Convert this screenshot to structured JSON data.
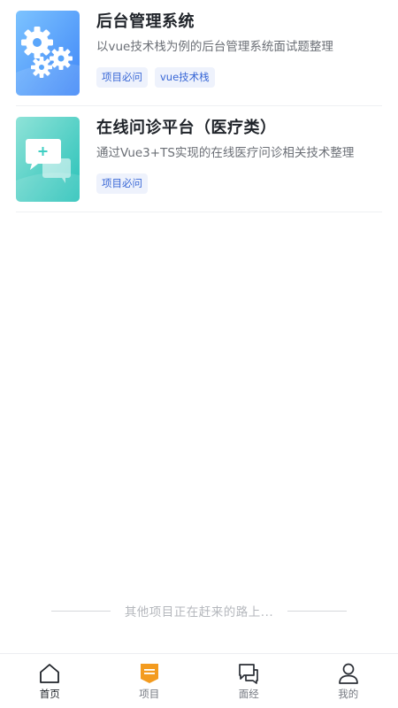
{
  "cards": [
    {
      "title": "后台管理系统",
      "desc": "以vue技术栈为例的后台管理系统面试题整理",
      "tags": [
        "项目必问",
        "vue技术栈"
      ],
      "thumb_icon": "gears-icon",
      "thumb_color": "#4d9cff"
    },
    {
      "title": "在线问诊平台（医疗类）",
      "desc": "通过Vue3+TS实现的在线医疗问诊相关技术整理",
      "tags": [
        "项目必问"
      ],
      "thumb_icon": "chat-bubbles-icon",
      "thumb_color": "#3fd1c4"
    }
  ],
  "footer_note": "其他项目正在赶来的路上...",
  "tabbar": {
    "active": "项目",
    "items": [
      {
        "label": "首页",
        "icon": "home-icon"
      },
      {
        "label": "项目",
        "icon": "project-icon",
        "color": "#f39b1f"
      },
      {
        "label": "面经",
        "icon": "chat-icon"
      },
      {
        "label": "我的",
        "icon": "user-icon"
      }
    ]
  }
}
